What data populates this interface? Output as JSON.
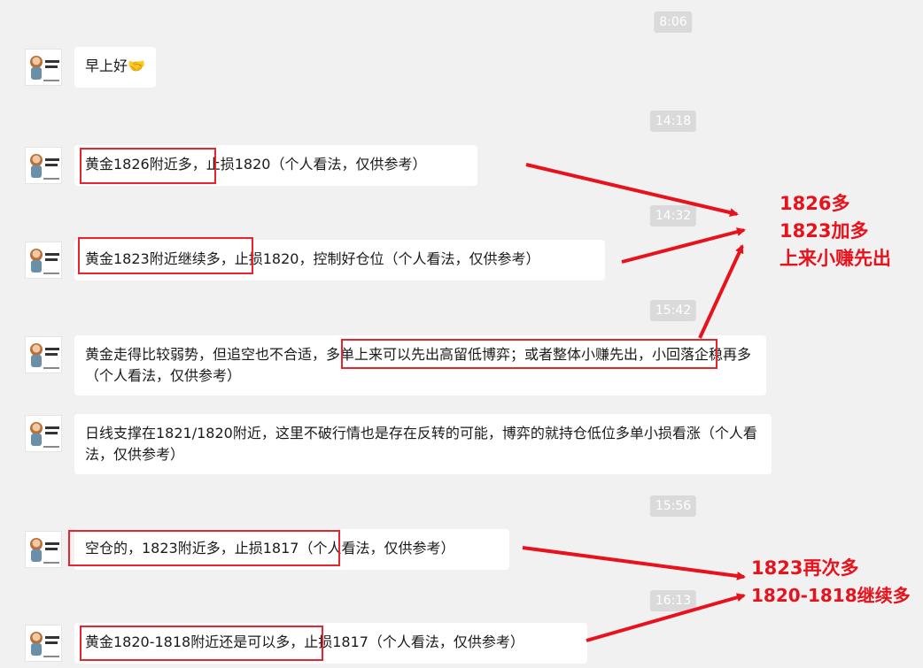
{
  "timestamps": [
    "8:06",
    "14:18",
    "14:32",
    "15:42",
    "15:56",
    "16:13"
  ],
  "messages": [
    {
      "text": "早上好🤝"
    },
    {
      "text": "黄金1826附近多，止损1820（个人看法，仅供参考）"
    },
    {
      "text": "黄金1823附近继续多，止损1820，控制好仓位（个人看法，仅供参考）"
    },
    {
      "text": "黄金走得比较弱势，但追空也不合适，多单上来可以先出高留低博弈；或者整体小赚先出，小回落企稳再多（个人看法，仅供参考）"
    },
    {
      "text": "日线支撑在1821/1820附近，这里不破行情也是存在反转的可能，博弈的就持仓低位多单小损看涨（个人看法，仅供参考）"
    },
    {
      "text": "空仓的，1823附近多，止损1817（个人看法，仅供参考）"
    },
    {
      "text": "黄金1820-1818附近还是可以多，止损1817（个人看法，仅供参考）"
    }
  ],
  "annotations": {
    "group1": [
      "1826多",
      "1823加多",
      "上来小赚先出"
    ],
    "group2": [
      "1823再次多",
      "1820-1818继续多"
    ],
    "color": "#e8121c"
  },
  "avatar": {
    "icon": "user-avatar-icon"
  }
}
